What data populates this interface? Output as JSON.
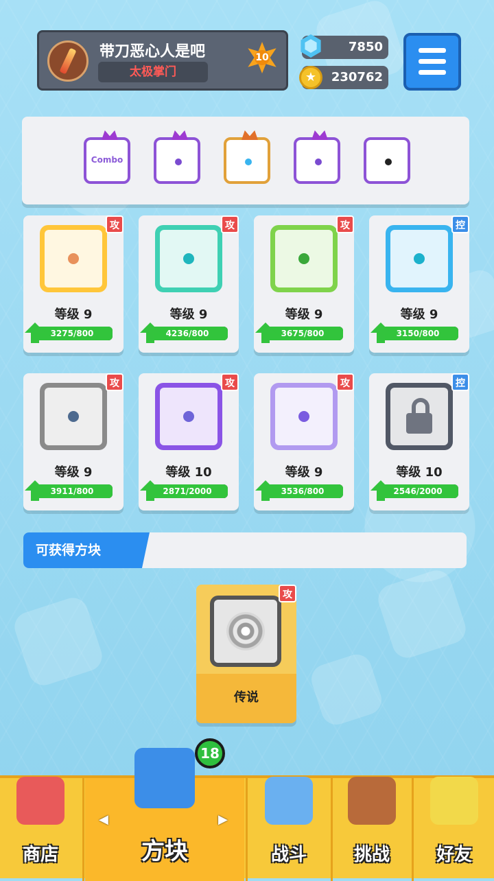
{
  "player": {
    "name": "带刀恶心人是吧",
    "clan": "太极掌门",
    "level_badge": "10"
  },
  "resources": {
    "gems": "7850",
    "gold": "230762"
  },
  "deck": [
    {
      "icon": "combo-dice-icon",
      "text": "Combo"
    },
    {
      "icon": "purple-dice-icon",
      "text": ""
    },
    {
      "icon": "rainbow-dice-icon",
      "text": ""
    },
    {
      "icon": "magic-dice-icon",
      "text": ""
    },
    {
      "icon": "mystery-dice-icon",
      "text": ""
    }
  ],
  "cards": [
    {
      "tag": "攻",
      "level": "等级 9",
      "progress": "3275/800",
      "color": "#ffc63a",
      "pip": "#e8915b",
      "icon": "fire-dice-icon"
    },
    {
      "tag": "攻",
      "level": "等级 9",
      "progress": "4236/800",
      "color": "#3fd0b3",
      "pip": "#1fb6bd",
      "icon": "wind-dice-icon"
    },
    {
      "tag": "攻",
      "level": "等级 9",
      "progress": "3675/800",
      "color": "#7fd34b",
      "pip": "#3aa83a",
      "icon": "poison-dice-icon"
    },
    {
      "tag": "控",
      "level": "等级 9",
      "progress": "3150/800",
      "color": "#39b4ef",
      "pip": "#1cb1cc",
      "icon": "ice-dice-icon"
    },
    {
      "tag": "攻",
      "level": "等级 9",
      "progress": "3911/800",
      "color": "#8a8a8a",
      "pip": "#4d6a8f",
      "icon": "gear-dice-icon"
    },
    {
      "tag": "攻",
      "level": "等级 10",
      "progress": "2871/2000",
      "color": "#8a54e6",
      "pip": "#6e64d8",
      "icon": "shift-dice-icon"
    },
    {
      "tag": "攻",
      "level": "等级 9",
      "progress": "3536/800",
      "color": "#b19af0",
      "pip": "#7a5ce0",
      "icon": "random-dice-icon"
    },
    {
      "tag": "控",
      "level": "等级 10",
      "progress": "2546/2000",
      "color": "#515866",
      "pip": "#222",
      "icon": "lock-dice-icon"
    }
  ],
  "section": {
    "title": "可获得方块"
  },
  "legendary": {
    "tag": "攻",
    "rarity": "传说",
    "icon": "black-hole-dice-icon"
  },
  "nav": {
    "shop": "商店",
    "dice": "方块",
    "battle": "战斗",
    "challenge": "挑战",
    "friends": "好友",
    "dice_badge": "18"
  },
  "colors": {
    "attack_tag": "#e94b4b",
    "control_tag": "#3c8ee8",
    "accent_blue": "#2b8ef0",
    "nav_bg": "#f7c93a"
  }
}
